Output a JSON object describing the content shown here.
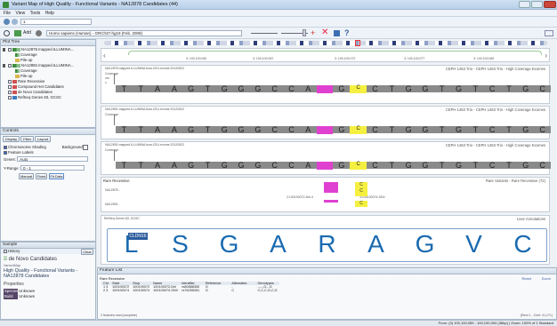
{
  "window": {
    "title": "Variant Map of High Quality - Functional Variants - NA12878 Candidates (44)"
  },
  "menu": [
    "File",
    "View",
    "Tools",
    "Help"
  ],
  "nav": {
    "zoom_value": "1",
    "location": "3: 100,100,059 - 100,100,094"
  },
  "toolbar2": {
    "add_label": "Add",
    "genome": "Homo sapiens (Human) - GRCh37-hg19 (Feb. 2009)"
  },
  "plot_tree": {
    "title": "Plot Tree",
    "items": [
      "NA12878.mapped.ILLUMINA...",
      "Coverage",
      "Pile-up",
      "NA12892.mapped.ILLUMINA...",
      "Coverage",
      "Pile-up",
      "Rare Recessive",
      "Compound Het Candidates",
      "de Novo Candidates",
      "RefSeq Genes 83, GCSC"
    ]
  },
  "controls": {
    "title": "Controls",
    "tabs": [
      "Display",
      "Filter",
      "Layout"
    ],
    "chk_shading": "Chromosome Shading",
    "background_label": "Background",
    "chk_feature": "Feature Labels",
    "genes_label": "Genes:",
    "genes_value": "Auto",
    "y_range_label": "Y-Range:",
    "y_range_value": "0 - 1",
    "buttons": [
      "Manual",
      "Fixed",
      "Fit Data"
    ]
  },
  "sample": {
    "title": "Sample",
    "history": "History",
    "clear": "Clear",
    "logo_text": "de Novo Candidates",
    "sample_label": "VariantMap",
    "heading": "High Quality - Functional Variants - NA12878 Candidates",
    "properties": "Properties",
    "prop_rows": [
      {
        "k": "Species",
        "v": "Unknown"
      },
      {
        "k": "Build",
        "v": "Unknown"
      }
    ]
  },
  "ruler": {
    "ticks": [
      "3: 100,100,062",
      "3: 100,100,067",
      "3: 100,100,072",
      "3: 100,100,077",
      "3: 100,100,082"
    ]
  },
  "tracks": {
    "t1_info": "NA12878.mapped.ILLUMINA.bwa.CEU.exome.20120522",
    "t1_name": "CEPH 1463 Trio - CEPH 1463 Trio - High Coverage Exomes",
    "t2_info": "NA12891.mapped.ILLUMINA.bwa.CEU.exome.20120522",
    "t2_name": "CEPH 1463 Trio - CEPH 1463 Trio - High Coverage Exomes",
    "t3_info": "NA12892.mapped.ILLUMINA.bwa.CEU.exome.20120522",
    "t3_name": "CEPH 1463 Trio - CEPH 1463 Trio - High Coverage Exomes",
    "cov": "Coverage",
    "cov_ticks": [
      "250",
      "125",
      "0"
    ],
    "seq1": [
      "T",
      "T",
      "A",
      "A",
      "G",
      "T",
      "G",
      "G",
      "G",
      "C",
      "C",
      "A",
      "",
      "G",
      "C",
      "C",
      "T",
      "G",
      "G",
      "T",
      "G",
      "T",
      "C",
      "T",
      "G",
      "C"
    ],
    "seq2": [
      "T",
      "T",
      "A",
      "A",
      "G",
      "T",
      "G",
      "G",
      "G",
      "C",
      "C",
      "A",
      "",
      "G",
      "C",
      "C",
      "T",
      "G",
      "G",
      "T",
      "G",
      "T",
      "C",
      "T",
      "G",
      "C"
    ],
    "seq3": [
      "T",
      "T",
      "A",
      "A",
      "G",
      "T",
      "G",
      "G",
      "G",
      "C",
      "C",
      "A",
      "",
      "G",
      "C",
      "C",
      "T",
      "G",
      "G",
      "T",
      "G",
      "T",
      "C",
      "T",
      "G",
      "C"
    ]
  },
  "rare": {
    "title": "Rare Recessive",
    "right_title": "Rare Variants - Rare Recessive (72)",
    "row1": "NA12878 -",
    "row2": "NA12891 -",
    "var1": "2:100100072-Del-4",
    "var2": "3:100100074-SNV",
    "c_letters": [
      "C",
      "C",
      "C"
    ]
  },
  "refseq": {
    "info": "RefSeq Genes 83, GCSC",
    "right": "Liver Annotations",
    "gene": "CLDN16",
    "aa": [
      "L",
      "S",
      "G",
      "A",
      "R",
      "A",
      "G",
      "V",
      "C"
    ]
  },
  "feature_list": {
    "title": "Feature List",
    "sub": "Rare Recessive",
    "reset": "Reset",
    "zoom": "Zoom",
    "columns": [
      "Chr",
      "Start",
      "Stop",
      "Name",
      "Identifier",
      "Reference",
      "Alternates",
      "Genotypes"
    ],
    "rows": [
      [
        "1  3",
        "100100072",
        "100100072",
        "100100072-Del",
        "rs80888350",
        "G",
        "-",
        "-,-,-,G,-,G"
      ],
      [
        "2  3",
        "100100074",
        "100100074",
        "100100074-SNV",
        "rs76255281",
        "G",
        "C",
        "C,C,C,G,C,G"
      ]
    ],
    "footer": "2 features read (complete)",
    "right_footer": "(Elect 1 - Chr#: 41,171)"
  },
  "status": {
    "right": "From: (3) 100,100,059 - 100,100,094   (36bp)  |  Zoom: 100% of 1 Standard"
  }
}
